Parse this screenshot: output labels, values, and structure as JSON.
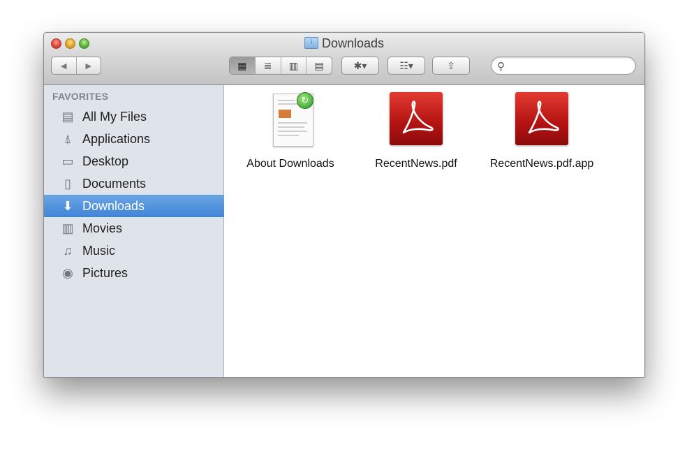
{
  "window": {
    "title": "Downloads"
  },
  "toolbar": {
    "back_glyph": "◀",
    "forward_glyph": "▶",
    "view_modes": [
      {
        "name": "icon-view",
        "glyph": "▦",
        "active": true
      },
      {
        "name": "list-view",
        "glyph": "≣",
        "active": false
      },
      {
        "name": "column-view",
        "glyph": "▥",
        "active": false
      },
      {
        "name": "coverflow-view",
        "glyph": "▤",
        "active": false
      }
    ],
    "action_glyph": "✱▾",
    "arrange_glyph": "☷▾",
    "share_glyph": "⇪",
    "search": {
      "value": "",
      "placeholder": ""
    }
  },
  "sidebar": {
    "heading": "FAVORITES",
    "items": [
      {
        "label": "All My Files",
        "icon": "all-my-files-icon",
        "glyph": "▤",
        "selected": false
      },
      {
        "label": "Applications",
        "icon": "applications-icon",
        "glyph": "⍋",
        "selected": false
      },
      {
        "label": "Desktop",
        "icon": "desktop-icon",
        "glyph": "▭",
        "selected": false
      },
      {
        "label": "Documents",
        "icon": "documents-icon",
        "glyph": "▯",
        "selected": false
      },
      {
        "label": "Downloads",
        "icon": "downloads-icon",
        "glyph": "⬇",
        "selected": true
      },
      {
        "label": "Movies",
        "icon": "movies-icon",
        "glyph": "▥",
        "selected": false
      },
      {
        "label": "Music",
        "icon": "music-icon",
        "glyph": "♫",
        "selected": false
      },
      {
        "label": "Pictures",
        "icon": "pictures-icon",
        "glyph": "◉",
        "selected": false
      }
    ]
  },
  "files": [
    {
      "name": "About Downloads",
      "type": "document"
    },
    {
      "name": "RecentNews.pdf",
      "type": "pdf"
    },
    {
      "name": "RecentNews.pdf.app",
      "type": "pdf"
    }
  ],
  "colors": {
    "selection": "#3f84d6",
    "sidebar_bg": "#dfe4ea",
    "pdf_red": "#c8201a"
  }
}
